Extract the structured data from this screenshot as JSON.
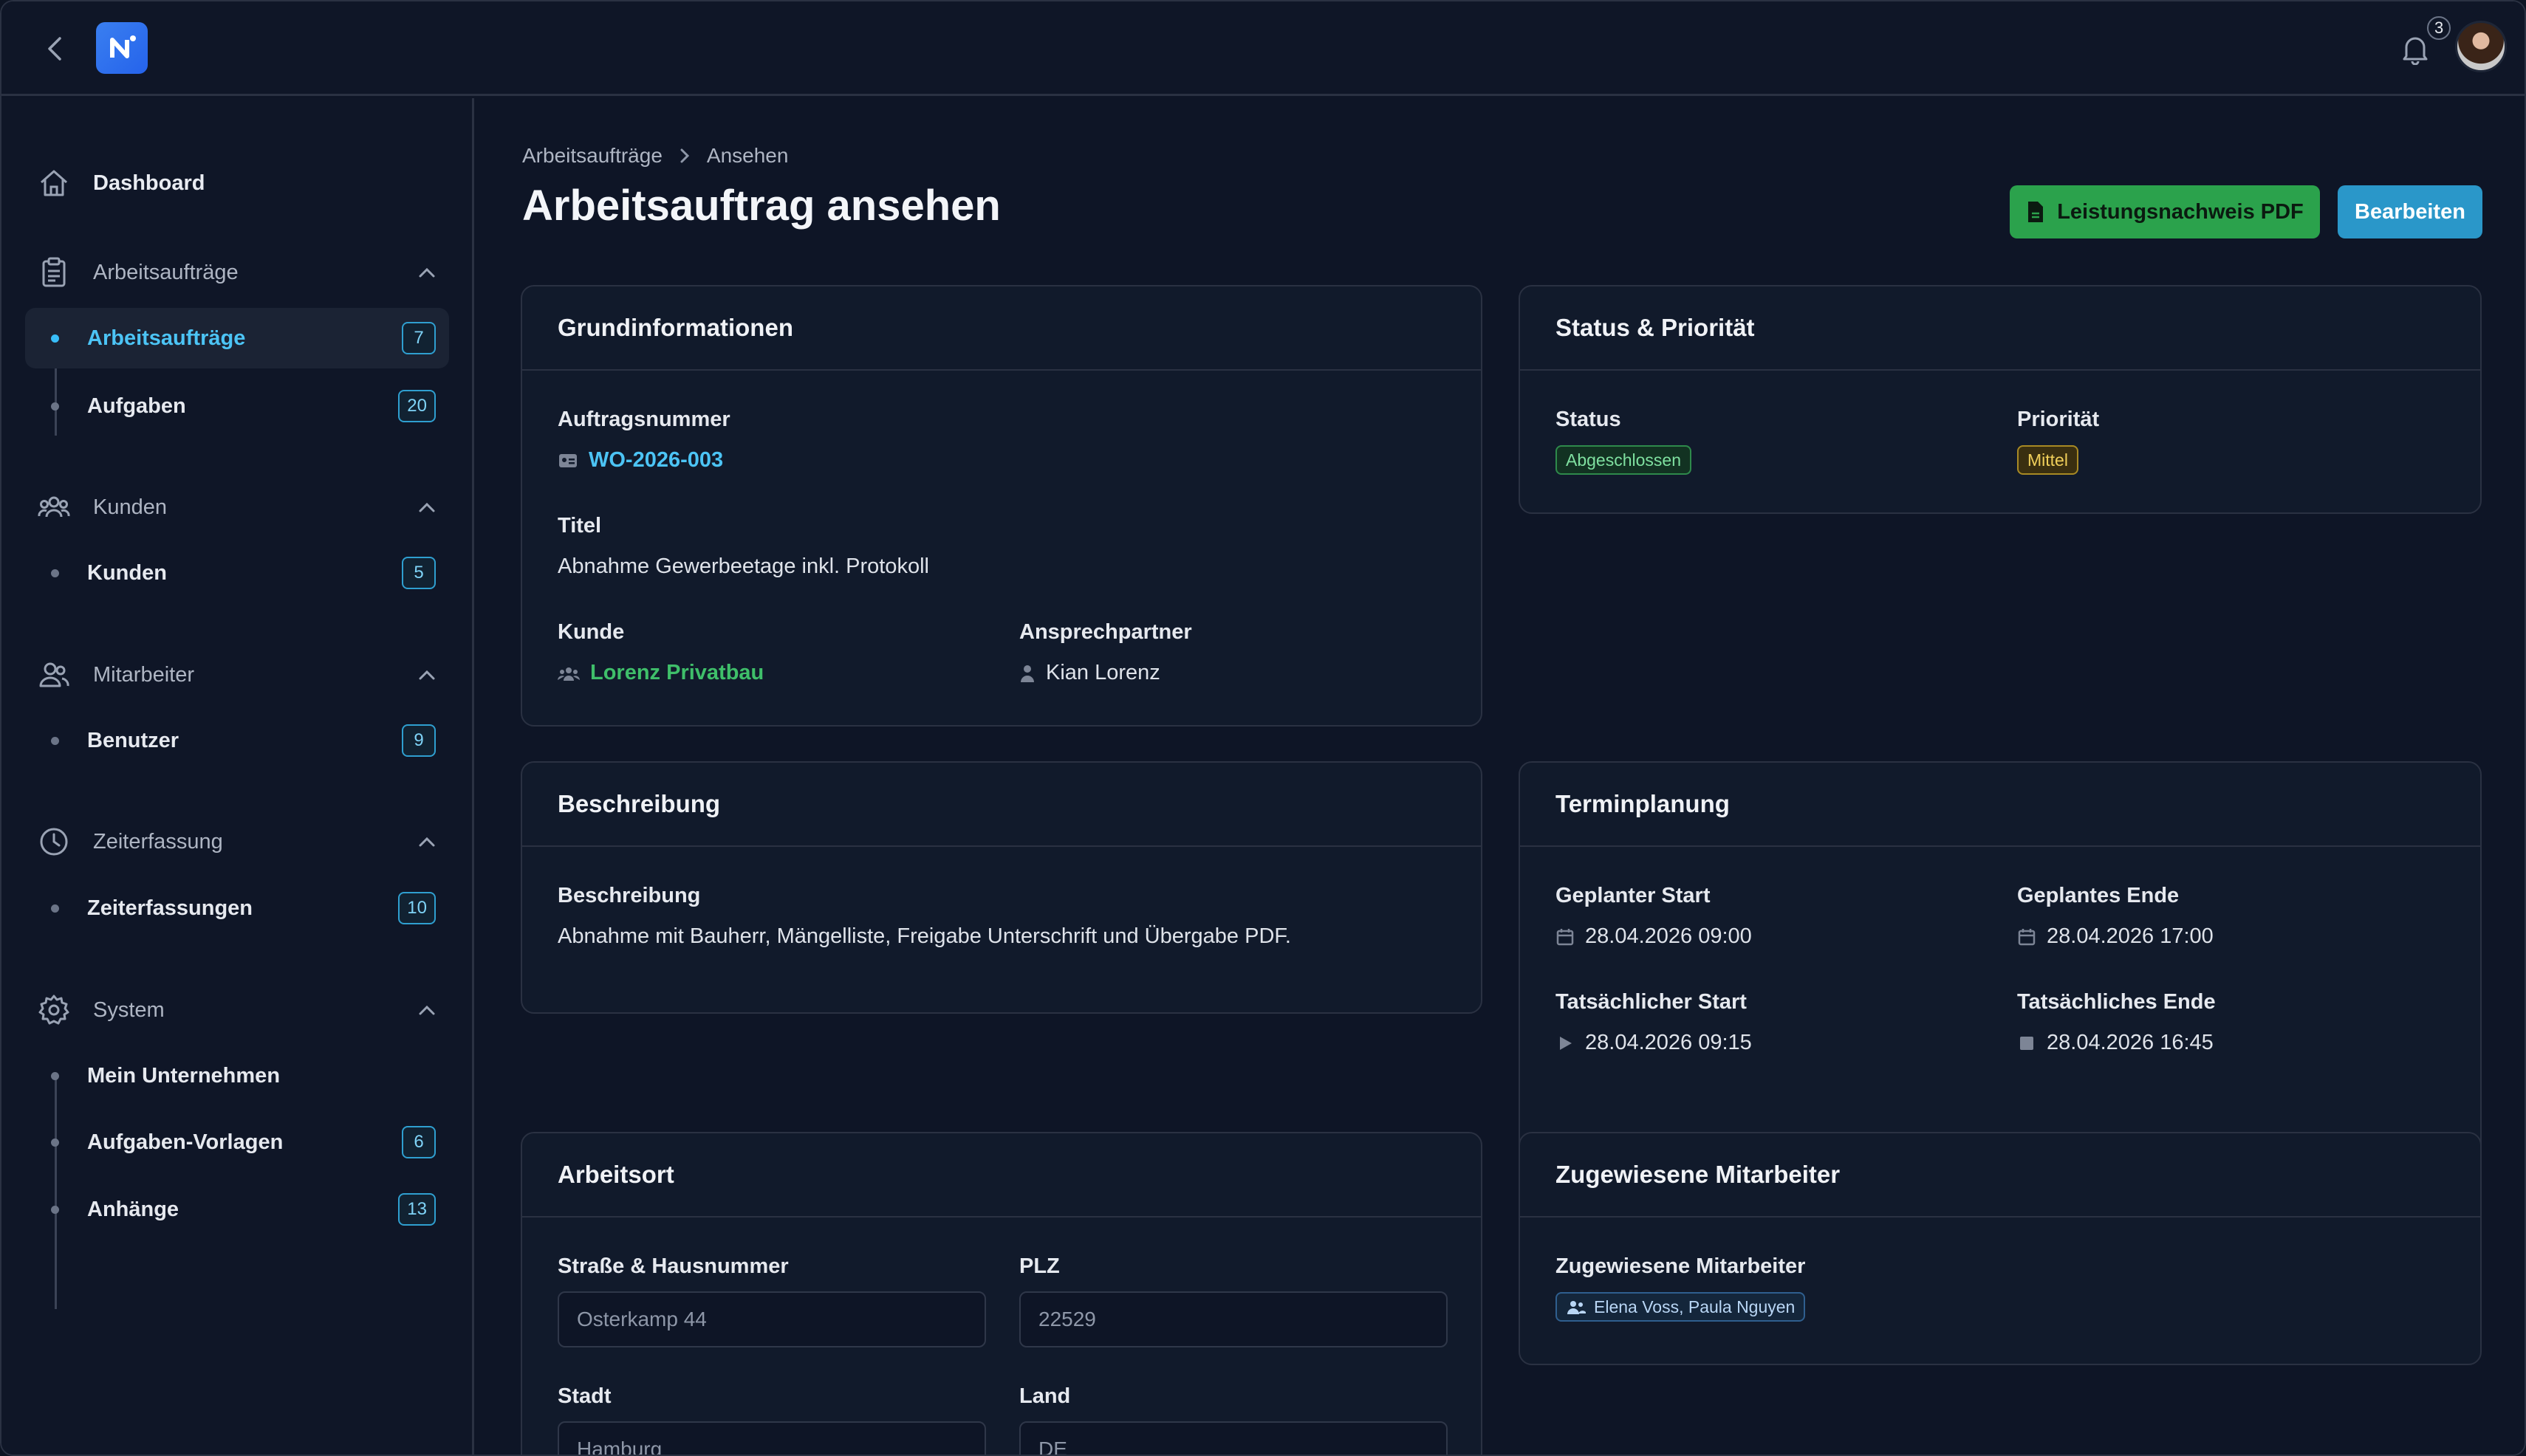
{
  "topbar": {
    "notification_count": "3"
  },
  "sidebar": {
    "dashboard": "Dashboard",
    "groups": [
      {
        "label": "Arbeitsaufträge",
        "items": [
          {
            "label": "Arbeitsaufträge",
            "count": "7"
          },
          {
            "label": "Aufgaben",
            "count": "20"
          }
        ]
      },
      {
        "label": "Kunden",
        "items": [
          {
            "label": "Kunden",
            "count": "5"
          }
        ]
      },
      {
        "label": "Mitarbeiter",
        "items": [
          {
            "label": "Benutzer",
            "count": "9"
          }
        ]
      },
      {
        "label": "Zeiterfassung",
        "items": [
          {
            "label": "Zeiterfassungen",
            "count": "10"
          }
        ]
      },
      {
        "label": "System",
        "items": [
          {
            "label": "Mein Unternehmen"
          },
          {
            "label": "Aufgaben-Vorlagen",
            "count": "6"
          },
          {
            "label": "Anhänge",
            "count": "13"
          }
        ]
      }
    ]
  },
  "breadcrumb": {
    "parent": "Arbeitsaufträge",
    "current": "Ansehen"
  },
  "page": {
    "title": "Arbeitsauftrag ansehen"
  },
  "actions": {
    "pdf_label": "Leistungsnachweis PDF",
    "edit_label": "Bearbeiten"
  },
  "grund": {
    "title": "Grundinformationen",
    "order_label": "Auftragsnummer",
    "order_value": "WO-2026-003",
    "title_label": "Titel",
    "title_value": "Abnahme Gewerbeetage inkl. Protokoll",
    "customer_label": "Kunde",
    "customer_value": "Lorenz Privatbau",
    "contact_label": "Ansprechpartner",
    "contact_value": "Kian Lorenz"
  },
  "status": {
    "title": "Status & Priorität",
    "status_label": "Status",
    "status_value": "Abgeschlossen",
    "priority_label": "Priorität",
    "priority_value": "Mittel"
  },
  "desc": {
    "title": "Beschreibung",
    "label": "Beschreibung",
    "value": "Abnahme mit Bauherr, Mängelliste, Freigabe Unterschrift und Übergabe PDF."
  },
  "termin": {
    "title": "Terminplanung",
    "planned_start_label": "Geplanter Start",
    "planned_start": "28.04.2026 09:00",
    "planned_end_label": "Geplantes Ende",
    "planned_end": "28.04.2026 17:00",
    "actual_start_label": "Tatsächlicher Start",
    "actual_start": "28.04.2026 09:15",
    "actual_end_label": "Tatsächliches Ende",
    "actual_end": "28.04.2026 16:45"
  },
  "ort": {
    "title": "Arbeitsort",
    "street_label": "Straße & Hausnummer",
    "street": "Osterkamp 44",
    "zip_label": "PLZ",
    "zip": "22529",
    "city_label": "Stadt",
    "city": "Hamburg",
    "country_label": "Land",
    "country": "DE"
  },
  "team": {
    "title": "Zugewiesene Mitarbeiter",
    "label": "Zugewiesene Mitarbeiter",
    "value": "Elena Voss, Paula Nguyen"
  },
  "colors": {
    "accent": "#38bdf8",
    "success": "#2ba24c",
    "primary": "#2a97c9",
    "background": "#0e1526"
  }
}
